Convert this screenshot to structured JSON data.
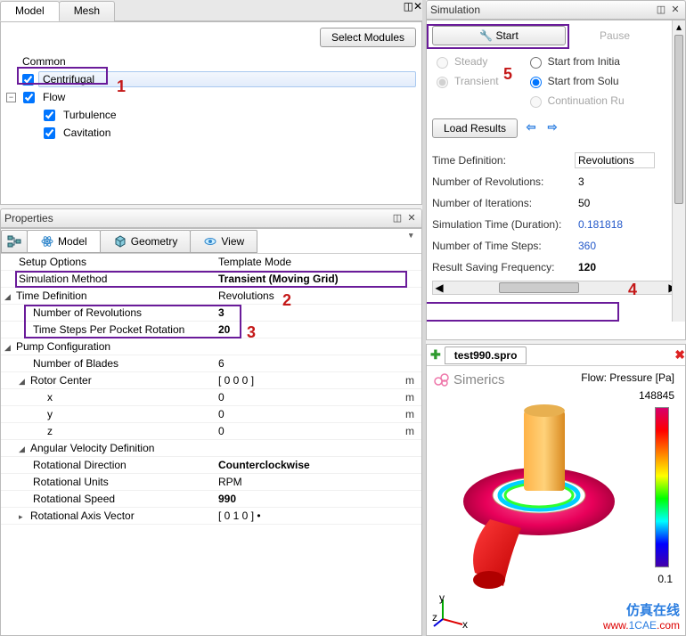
{
  "left": {
    "model_tab": "Model",
    "mesh_tab": "Mesh",
    "select_modules": "Select Modules",
    "tree": {
      "common": "Common",
      "centrifugal": "Centrifugal",
      "flow": "Flow",
      "turbulence": "Turbulence",
      "cavitation": "Cavitation"
    },
    "properties_title": "Properties",
    "prop_tabs": {
      "model": "Model",
      "geometry": "Geometry",
      "view": "View"
    },
    "grid": {
      "setup_options": "Setup Options",
      "setup_options_val": "Template Mode",
      "sim_method": "Simulation Method",
      "sim_method_val": "Transient (Moving Grid)",
      "time_def": "Time Definition",
      "time_def_val": "Revolutions",
      "num_revs": "Number of Revolutions",
      "num_revs_val": "3",
      "tspr": "Time Steps Per Pocket Rotation",
      "tspr_val": "20",
      "pump_config": "Pump Configuration",
      "num_blades": "Number of Blades",
      "num_blades_val": "6",
      "rotor_center": "Rotor Center",
      "rotor_center_val": "[ 0 0 0 ]",
      "x": "x",
      "x_val": "0",
      "y": "y",
      "y_val": "0",
      "z": "z",
      "z_val": "0",
      "ang_vel": "Angular Velocity Definition",
      "rot_dir": "Rotational Direction",
      "rot_dir_val": "Counterclockwise",
      "rot_units": "Rotational Units",
      "rot_units_val": "RPM",
      "rot_speed": "Rotational Speed",
      "rot_speed_val": "990",
      "rot_axis": "Rotational Axis Vector",
      "rot_axis_val": "[ 0 1 0 ] •",
      "unit_m": "m"
    }
  },
  "sim": {
    "title": "Simulation",
    "start": "Start",
    "pause": "Pause",
    "steady": "Steady",
    "transient": "Transient",
    "start_from_initial": "Start from Initia",
    "start_from_solu": "Start from Solu",
    "continuation": "Continuation Ru",
    "load_results": "Load Results",
    "time_definition": "Time Definition:",
    "time_definition_val": "Revolutions",
    "num_revs": "Number of Revolutions:",
    "num_revs_val": "3",
    "num_iter": "Number of Iterations:",
    "num_iter_val": "50",
    "sim_time": "Simulation Time (Duration):",
    "sim_time_val": "0.181818",
    "num_steps": "Number of Time Steps:",
    "num_steps_val": "360",
    "save_freq": "Result Saving Frequency:",
    "save_freq_val": "120"
  },
  "viz": {
    "tab": "test990.spro",
    "brand": "Simerics",
    "legend_title": "Flow: Pressure [Pa]",
    "max_val": "148845",
    "min_val": "0.1",
    "axes": {
      "x": "x",
      "y": "y",
      "z": "z"
    }
  },
  "watermark": {
    "cn": "仿真在线",
    "url": "www.1CAE.com"
  },
  "annotations": {
    "n1": "1",
    "n2": "2",
    "n3": "3",
    "n4": "4",
    "n5": "5"
  }
}
